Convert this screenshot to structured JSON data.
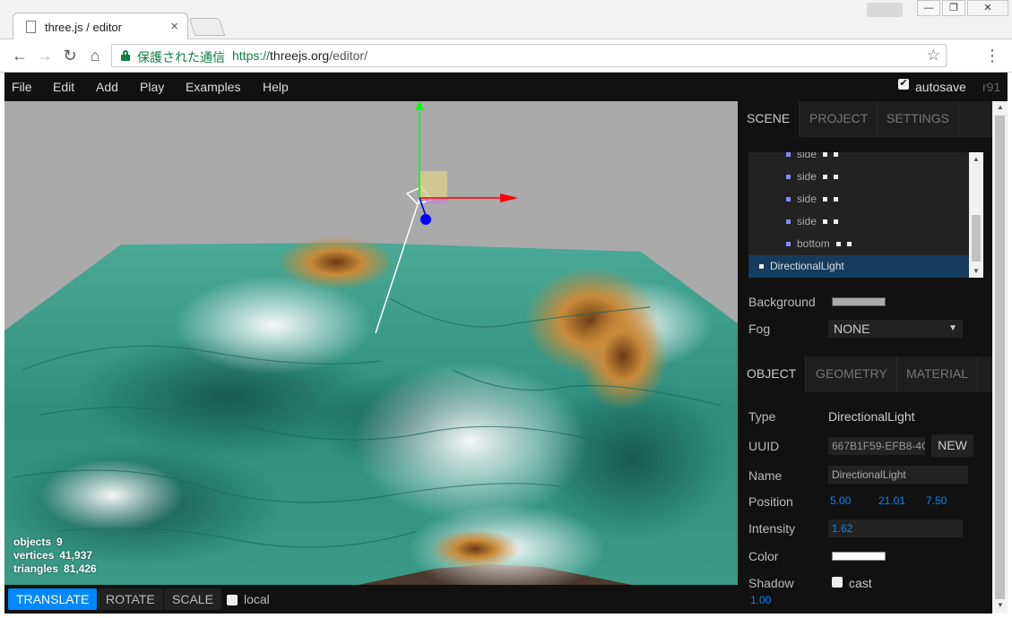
{
  "browser": {
    "tab_title": "three.js / editor",
    "tab_close": "×",
    "secure_label": "保護された通信",
    "url_scheme": "https://",
    "url_host": "threejs.org",
    "url_path": "/editor/",
    "window_minimize": "—",
    "window_maximize": "❐",
    "window_close": "✕"
  },
  "menubar": {
    "items": [
      "File",
      "Edit",
      "Add",
      "Play",
      "Examples",
      "Help"
    ],
    "autosave_label": "autosave",
    "autosave_checked": "✔",
    "revision": "r91"
  },
  "viewport": {
    "info": {
      "objects_label": "objects",
      "objects_value": "9",
      "vertices_label": "vertices",
      "vertices_value": "41,937",
      "triangles_label": "triangles",
      "triangles_value": "81,426"
    }
  },
  "toolbar": {
    "translate": "TRANSLATE",
    "rotate": "ROTATE",
    "scale": "SCALE",
    "local": "local"
  },
  "sidebar": {
    "tabs": [
      "SCENE",
      "PROJECT",
      "SETTINGS"
    ],
    "outliner": [
      {
        "label": "side"
      },
      {
        "label": "side"
      },
      {
        "label": "side"
      },
      {
        "label": "side"
      },
      {
        "label": "bottom"
      },
      {
        "label": "DirectionalLight"
      }
    ],
    "background_label": "Background",
    "background_color": "#aaaaaa",
    "fog_label": "Fog",
    "fog_value": "NONE",
    "object_tabs": [
      "OBJECT",
      "GEOMETRY",
      "MATERIAL"
    ],
    "type_label": "Type",
    "type_value": "DirectionalLight",
    "uuid_label": "UUID",
    "uuid_value": "667B1F59-EFB8-4C",
    "new_button": "NEW",
    "name_label": "Name",
    "name_value": "DirectionalLight",
    "position_label": "Position",
    "position_x": "5.00",
    "position_y": "21.01",
    "position_z": "7.50",
    "intensity_label": "Intensity",
    "intensity_value": "1.62",
    "color_label": "Color",
    "color_value": "#ffffff",
    "shadow_label": "Shadow",
    "shadow_cast": "cast",
    "shadow_value": "1.00"
  },
  "colors": {
    "accent": "#0088ff",
    "selected_row": "#153c5e",
    "secure": "#0b8043"
  }
}
